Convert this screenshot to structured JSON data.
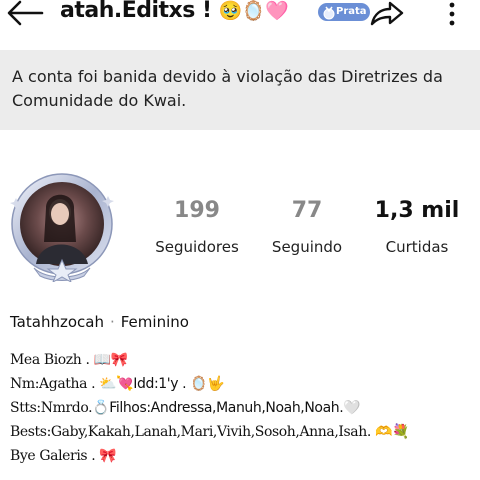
{
  "header": {
    "username": "atah.Editxs !",
    "username_emojis": "🥹🪞🩷",
    "badge_label": "Prata"
  },
  "ban_notice": "A conta foi banida devido à violação das Diretrizes da Comunidade do Kwai.",
  "stats": [
    {
      "value": "199",
      "label": "Seguidores"
    },
    {
      "value": "77",
      "label": "Seguindo"
    },
    {
      "value": "1,3 mil",
      "label": "Curtidas"
    }
  ],
  "profile": {
    "handle": "Tatahhzocah",
    "separator": "·",
    "gender": "Feminino"
  },
  "bio_lines": [
    {
      "text": "Mea Biozh .",
      "emoji": " 📖🎀"
    },
    {
      "text": "Nm:Agatha .",
      "emoji": " ⛅💘Idd:1'y . 🪞🤟"
    },
    {
      "text": "Stts:Nmrdo.",
      "emoji": "💍Filhos:Andressa,Manuh,Noah,Noah.🤍"
    },
    {
      "text": "Bests:Gaby,Kakah,Lanah,Mari,Vivih,Sosoh,Anna,Isah.",
      "emoji": " 🫶💐"
    },
    {
      "text": "Bye Galeris .",
      "emoji": " 🎀"
    }
  ],
  "colors": {
    "stat_muted": "#888888",
    "stat_strong": "#111111",
    "badge": "#6b8fd6",
    "ban_bg": "#ececec"
  }
}
